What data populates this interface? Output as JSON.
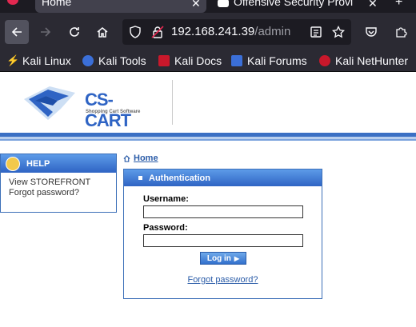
{
  "browser": {
    "tabs": [
      {
        "label": "Home"
      },
      {
        "label": "Offensive Security Provi"
      }
    ],
    "url_host": "192.168.241.39",
    "url_path": "/admin",
    "bookmarks": [
      {
        "label": "Kali Linux",
        "icon": "kali-icon"
      },
      {
        "label": "Kali Tools",
        "icon": "kali-tools-icon"
      },
      {
        "label": "Kali Docs",
        "icon": "kali-docs-icon"
      },
      {
        "label": "Kali Forums",
        "icon": "kali-forums-icon"
      },
      {
        "label": "Kali NetHunter",
        "icon": "kali-nethunter-icon"
      }
    ]
  },
  "logo": {
    "text": "CS-CART",
    "tagline": "Shopping Cart Software"
  },
  "help": {
    "title": "HELP",
    "links": [
      "View STOREFRONT",
      "Forgot password?"
    ]
  },
  "breadcrumb": {
    "home": "Home"
  },
  "auth": {
    "title": "Authentication",
    "username_label": "Username:",
    "password_label": "Password:",
    "login_button": "Log in",
    "forgot_link": "Forgot password?"
  },
  "colors": {
    "accent": "#2f64c4",
    "link": "#2b5ca8"
  }
}
